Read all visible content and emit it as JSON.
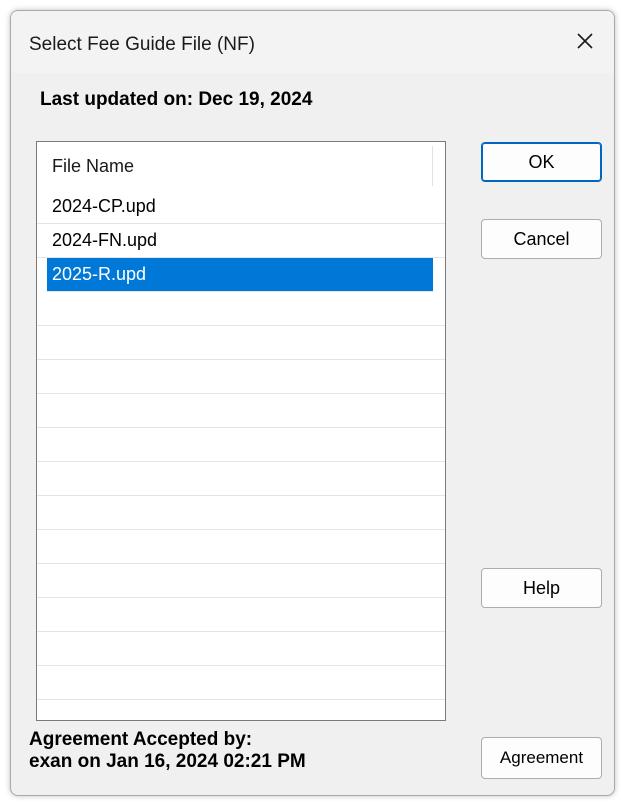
{
  "window": {
    "title": "Select Fee Guide File (NF)"
  },
  "last_updated": "Last updated on: Dec 19, 2024",
  "file_list": {
    "column_header": "File Name",
    "items": [
      "2024-CP.upd",
      "2024-FN.upd",
      "2025-R.upd"
    ],
    "selected_index": 2
  },
  "buttons": {
    "ok": "OK",
    "cancel": "Cancel",
    "help": "Help",
    "agreement": "Agreement"
  },
  "agreement": {
    "line1": "Agreement Accepted by:",
    "line2": "exan on Jan 16, 2024 02:21 PM"
  },
  "colors": {
    "selection": "#0078d7",
    "default_button_border": "#0067c0",
    "dialog_background": "#f0f0f0"
  },
  "icons": {
    "close": "close-icon"
  }
}
